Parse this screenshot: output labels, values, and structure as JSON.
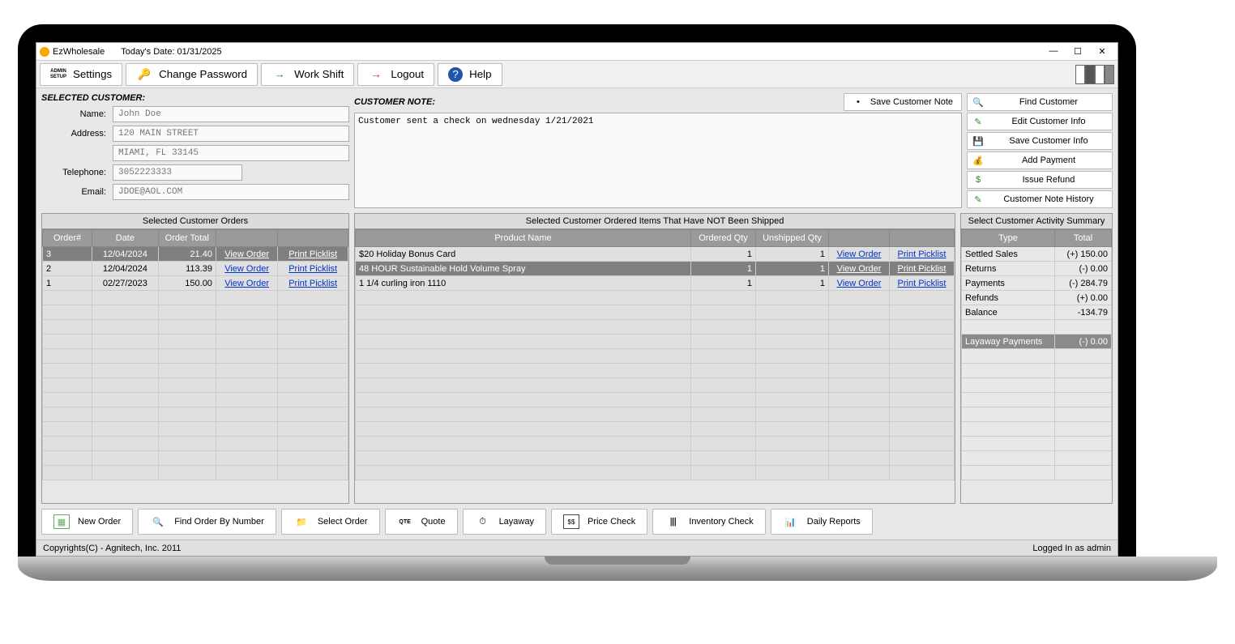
{
  "title": {
    "app": "EzWholesale",
    "date_label": "Today's Date: 01/31/2025"
  },
  "toolbar": {
    "settings": "Settings",
    "change_pw": "Change Password",
    "work_shift": "Work Shift",
    "logout": "Logout",
    "help": "Help"
  },
  "customer": {
    "heading": "SELECTED CUSTOMER:",
    "name_label": "Name:",
    "name": "John Doe",
    "address_label": "Address:",
    "address1": "120 MAIN STREET",
    "address2": "MIAMI, FL 33145",
    "phone_label": "Telephone:",
    "phone": "3052223333",
    "email_label": "Email:",
    "email": "JDOE@AOL.COM"
  },
  "note": {
    "heading": "CUSTOMER NOTE:",
    "save_btn": "Save Customer Note",
    "text": "Customer sent a check on wednesday 1/21/2021"
  },
  "side": {
    "find": "Find Customer",
    "edit": "Edit Customer Info",
    "save": "Save Customer Info",
    "add_pay": "Add Payment",
    "refund": "Issue Refund",
    "note_hist": "Customer Note History"
  },
  "orders": {
    "title": "Selected Customer Orders",
    "cols": [
      "Order#",
      "Date",
      "Order Total",
      "",
      ""
    ],
    "view": "View Order",
    "print": "Print Picklist",
    "rows": [
      {
        "n": "3",
        "d": "12/04/2024",
        "t": "21.40"
      },
      {
        "n": "2",
        "d": "12/04/2024",
        "t": "113.39"
      },
      {
        "n": "1",
        "d": "02/27/2023",
        "t": "150.00"
      }
    ]
  },
  "items": {
    "title": "Selected Customer Ordered Items That Have NOT Been Shipped",
    "cols": [
      "Product Name",
      "Ordered Qty",
      "Unshipped Qty",
      "",
      ""
    ],
    "view": "View Order",
    "print": "Print Picklist",
    "rows": [
      {
        "p": "$20 Holiday Bonus Card",
        "o": "1",
        "u": "1"
      },
      {
        "p": "48 HOUR Sustainable Hold Volume Spray",
        "o": "1",
        "u": "1"
      },
      {
        "p": "1 1/4 curling iron 1110",
        "o": "1",
        "u": "1"
      }
    ]
  },
  "summary": {
    "title": "Select Customer Activity Summary",
    "cols": [
      "Type",
      "Total"
    ],
    "rows": [
      {
        "t": "Settled Sales",
        "v": "(+) 150.00"
      },
      {
        "t": "Returns",
        "v": "(-) 0.00"
      },
      {
        "t": "Payments",
        "v": "(-) 284.79"
      },
      {
        "t": "Refunds",
        "v": "(+) 0.00"
      },
      {
        "t": "Balance",
        "v": "-134.79"
      }
    ],
    "layaway": {
      "t": "Layaway Payments",
      "v": "(-) 0.00"
    }
  },
  "bottom": {
    "new_order": "New Order",
    "find_order": "Find Order By Number",
    "select_order": "Select Order",
    "quote": "Quote",
    "layaway": "Layaway",
    "price_check": "Price Check",
    "inventory": "Inventory Check",
    "daily": "Daily Reports"
  },
  "status": {
    "copyright": "Copyrights(C) - Agnitech, Inc. 2011",
    "user": "Logged In as admin"
  }
}
